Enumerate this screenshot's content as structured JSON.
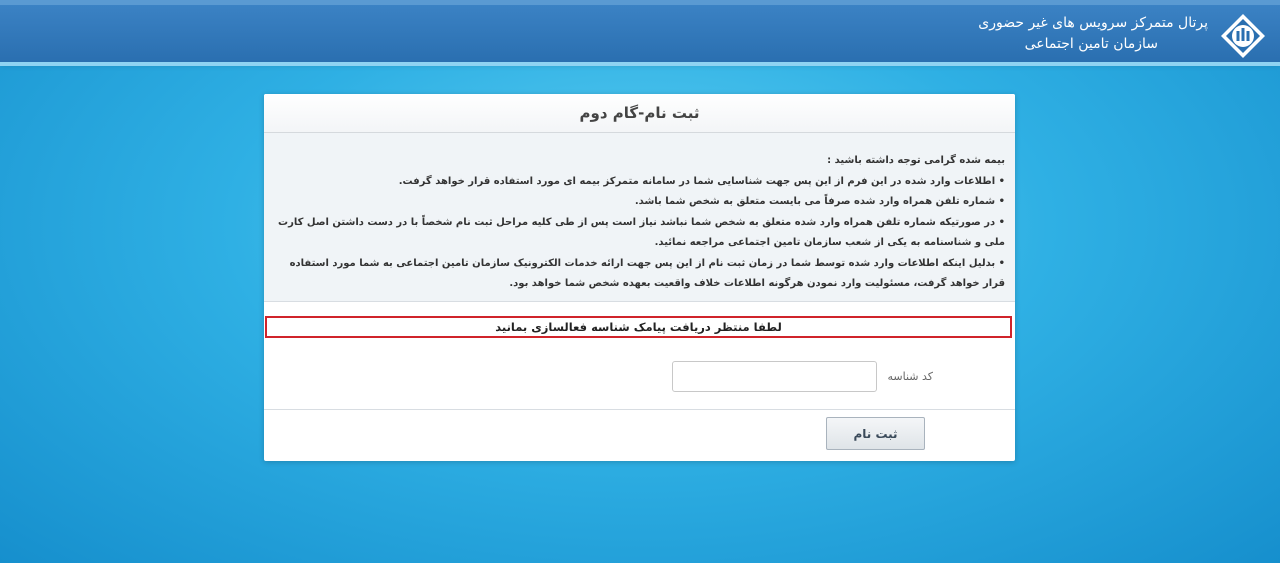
{
  "header": {
    "title_line1": "پرتال متمرکز سرویس های غیر حضوری",
    "title_line2": "سازمان تامین اجتماعی",
    "logo_icon": "social-security-logo"
  },
  "card": {
    "title": "ثبت نام-گام دوم",
    "notice": {
      "intro": "بیمه شده گرامی توجه داشته باشید :",
      "items": [
        "• اطلاعات وارد شده در این فرم از این پس جهت شناسایی شما در سامانه متمرکز بیمه ای مورد استفاده قرار خواهد گرفت.",
        "• شماره تلفن همراه وارد شده صرفاً می بایست متعلق به شخص شما باشد.",
        "• در صورتیکه شماره تلفن همراه وارد شده متعلق به شخص شما نباشد نیاز است پس از طی کلیه مراحل ثبت نام شخصاً با در دست داشتن اصل کارت ملی و شناسنامه به یکی از شعب سازمان تامین اجتماعی مراجعه نمائید.",
        "• بدلیل اینکه اطلاعات وارد شده توسط شما در زمان ثبت نام از این پس جهت ارائه خدمات الکترونیک سازمان تامین اجتماعی به شما مورد استفاده قرار خواهد گرفت، مسئولیت وارد نمودن هرگونه اطلاعات خلاف واقعیت بعهده شخص شما خواهد بود."
      ]
    },
    "alert": "لطفا منتظر دریافت پیامک شناسه فعالسازی بمانید",
    "field": {
      "label": "کد شناسه",
      "value": "",
      "placeholder": ""
    },
    "submit_label": "ثبت نام"
  },
  "colors": {
    "topbar": "#2a6fb0",
    "background": "#2fb0e4",
    "alert_border": "#d0242b"
  }
}
